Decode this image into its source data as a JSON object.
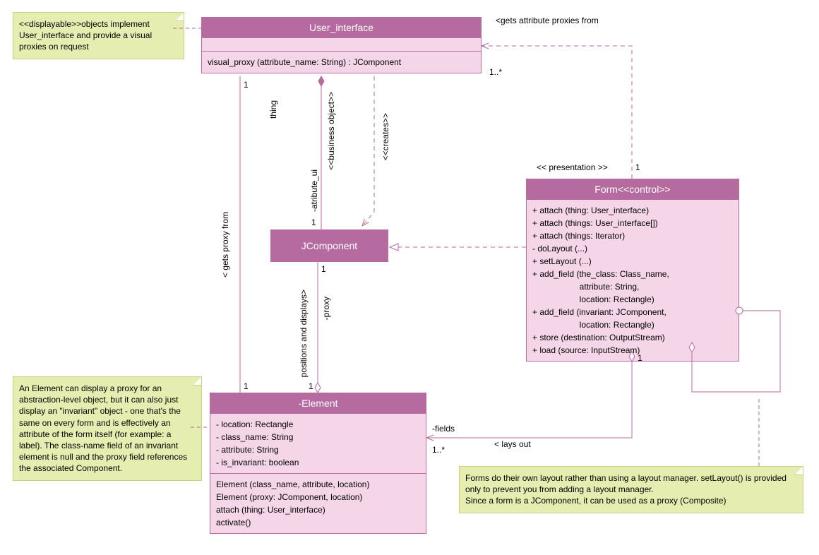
{
  "notes": {
    "displayable": "<<displayable>>objects implement User_interface and provide a visual proxies on request",
    "element": "An Element can display a proxy for an abstraction-level object, but it can also just display an \"invariant\" object - one that's the same on every form and is effectively an attribute of the form itself (for example: a label). The class-name field of an invariant element is null and the proxy field references the associated Component.",
    "form": "Forms do their own layout rather than using a layout manager. setLayout() is provided only to prevent you from adding a layout manager.\nSince a form is a JComponent, it can be used as a proxy (Composite)"
  },
  "classes": {
    "user_interface": {
      "name": "User_interface",
      "op": "visual_proxy (attribute_name: String) : JComponent"
    },
    "jcomponent": {
      "name": "JComponent"
    },
    "element": {
      "name": "-Element",
      "attrs": "- location: Rectangle\n- class_name: String\n- attribute: String\n- is_invariant: boolean",
      "ops": "Element (class_name, attribute, location)\nElement (proxy: JComponent, location)\nattach (thing: User_interface)\nactivate()"
    },
    "form": {
      "name": "Form<<control>>",
      "ops": "+ attach (thing: User_interface)\n+ attach (things: User_interface[])\n+ attach (things: Iterator)\n- doLayout (...)\n+ setLayout (...)\n+ add_field (the_class: Class_name,\n                    attribute: String,\n                    location: Rectangle)\n+ add_field (invariant: JComponent,\n                    location: Rectangle)\n+ store (destination: OutputStream)\n+ load (source: InputStream)"
    }
  },
  "labels": {
    "gets_attr": "<gets attribute proxies from",
    "presentation": "<< presentation >>",
    "thing": "thing",
    "business": "<<business object>>",
    "creates": "<<creates>>",
    "attribute_ui": "-atribute_ui",
    "gets_proxy": "< gets proxy from",
    "positions": "positions and displays>",
    "proxy": "-proxy",
    "fields": "-fields",
    "lays_out": "< lays out",
    "one": "1",
    "one_star": "1..*"
  },
  "chart_data": {
    "type": "uml_class_diagram",
    "classes": [
      {
        "id": "User_interface",
        "stereotype": "displayable",
        "operations": [
          "visual_proxy(attribute_name: String): JComponent"
        ]
      },
      {
        "id": "JComponent"
      },
      {
        "id": "Element",
        "visibility": "-",
        "attributes": [
          "- location: Rectangle",
          "- class_name: String",
          "- attribute: String",
          "- is_invariant: boolean"
        ],
        "operations": [
          "Element(class_name, attribute, location)",
          "Element(proxy: JComponent, location)",
          "attach(thing: User_interface)",
          "activate()"
        ]
      },
      {
        "id": "Form",
        "stereotype": "control",
        "operations": [
          "+ attach(thing: User_interface)",
          "+ attach(things: User_interface[])",
          "+ attach(things: Iterator)",
          "- doLayout(...)",
          "+ setLayout(...)",
          "+ add_field(the_class: Class_name, attribute: String, location: Rectangle)",
          "+ add_field(invariant: JComponent, location: Rectangle)",
          "+ store(destination: OutputStream)",
          "+ load(source: InputStream)"
        ]
      }
    ],
    "relationships": [
      {
        "from": "Form",
        "to": "User_interface",
        "type": "dependency",
        "label": "<gets attribute proxies from",
        "from_mult": "1",
        "to_mult": "1..*",
        "stereotype": "presentation"
      },
      {
        "from": "Element",
        "to": "User_interface",
        "type": "association",
        "label": "< gets proxy from",
        "role": "thing",
        "from_mult": "1",
        "to_mult": "1"
      },
      {
        "from": "User_interface",
        "to": "JComponent",
        "type": "composition",
        "stereotype": "business object",
        "role": "-atribute_ui",
        "to_mult": "1"
      },
      {
        "from": "User_interface",
        "to": "JComponent",
        "type": "dependency",
        "stereotype": "creates"
      },
      {
        "from": "Element",
        "to": "JComponent",
        "type": "aggregation",
        "label": "positions and displays>",
        "role": "-proxy",
        "from_mult": "1",
        "to_mult": "1"
      },
      {
        "from": "Form",
        "to": "JComponent",
        "type": "realization"
      },
      {
        "from": "Form",
        "to": "Element",
        "type": "aggregation",
        "label": "< lays out",
        "role": "-fields",
        "from_mult": "1",
        "to_mult": "1..*"
      },
      {
        "from": "Form",
        "to": "Form",
        "type": "aggregation",
        "self": true
      }
    ],
    "notes": [
      {
        "attached_to": "User_interface",
        "text": "<<displayable>>objects implement User_interface and provide a visual proxies on request"
      },
      {
        "attached_to": "Element",
        "text": "An Element can display a proxy for an abstraction-level object, but it can also just display an \"invariant\" object - one that's the same on every form and is effectively an attribute of the form itself (for example: a label). The class-name field of an invariant element is null and the proxy field references the associated Component."
      },
      {
        "attached_to": "Form",
        "text": "Forms do their own layout rather than using a layout manager. setLayout() is provided only to prevent you from adding a layout manager. Since a form is a JComponent, it can be used as a proxy (Composite)"
      }
    ]
  }
}
